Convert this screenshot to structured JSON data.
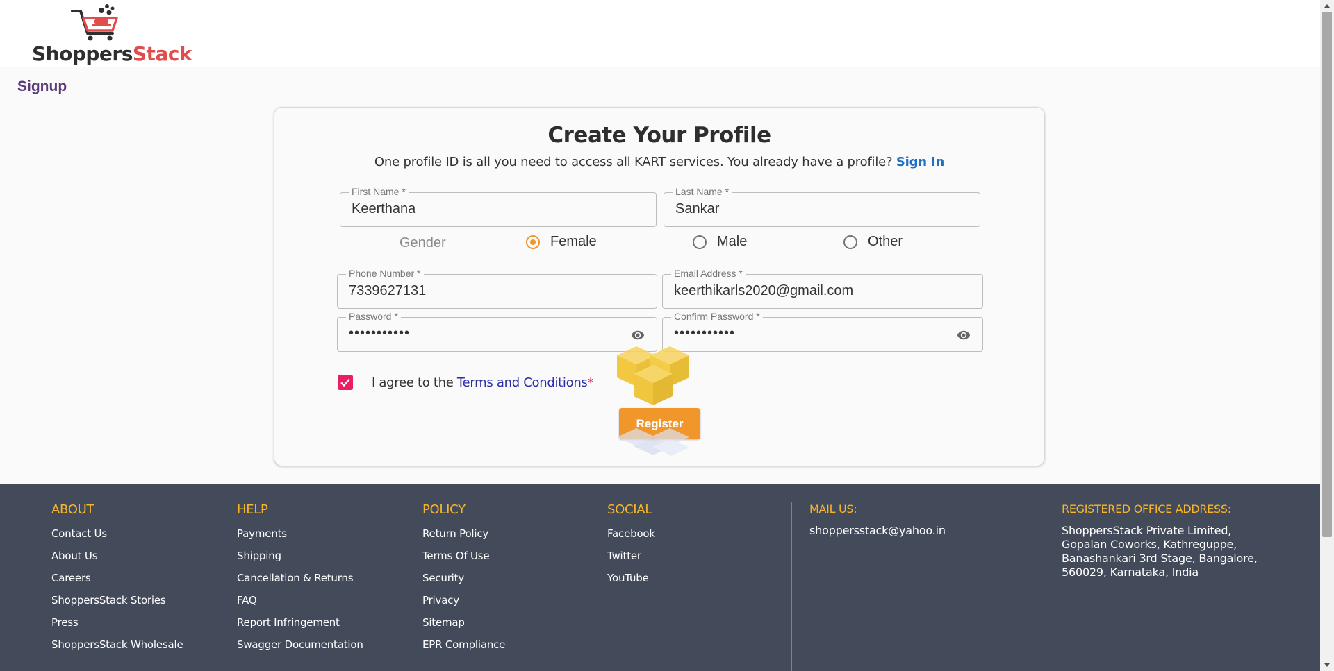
{
  "brand": {
    "name_part1": "Shoppers",
    "name_part2": "Stack",
    "accent": "#f0962b",
    "brand_red": "#e14d4d"
  },
  "page": {
    "title": "Signup"
  },
  "form": {
    "title": "Create Your Profile",
    "subtitle": "One profile ID is all you need to access all KART services. You already have a profile?",
    "sign_in_link": "Sign In",
    "first_name": {
      "label": "First Name *",
      "value": "Keerthana"
    },
    "last_name": {
      "label": "Last Name *",
      "value": "Sankar"
    },
    "gender": {
      "label": "Gender",
      "options": [
        "Female",
        "Male",
        "Other"
      ],
      "selected": "Female"
    },
    "phone": {
      "label": "Phone Number *",
      "value": "7339627131"
    },
    "email": {
      "label": "Email Address *",
      "value": "keerthikarls2020@gmail.com"
    },
    "password": {
      "label": "Password *",
      "value": "•••••••••••"
    },
    "confirm_password": {
      "label": "Confirm Password *",
      "value": "•••••••••••"
    },
    "agree_text": "I agree to the",
    "terms_link": "Terms and Conditions",
    "terms_required": "*",
    "terms_checked": true,
    "register_label": "Register"
  },
  "footer": {
    "about": {
      "heading": "ABOUT",
      "items": [
        "Contact Us",
        "About Us",
        "Careers",
        "ShoppersStack Stories",
        "Press",
        "ShoppersStack Wholesale"
      ]
    },
    "help": {
      "heading": "HELP",
      "items": [
        "Payments",
        "Shipping",
        "Cancellation & Returns",
        "FAQ",
        "Report Infringement",
        "Swagger Documentation"
      ]
    },
    "policy": {
      "heading": "POLICY",
      "items": [
        "Return Policy",
        "Terms Of Use",
        "Security",
        "Privacy",
        "Sitemap",
        "EPR Compliance"
      ]
    },
    "social": {
      "heading": "SOCIAL",
      "items": [
        "Facebook",
        "Twitter",
        "YouTube"
      ]
    },
    "mail": {
      "heading": "MAIL US:",
      "value": "shoppersstack@yahoo.in"
    },
    "office": {
      "heading": "REGISTERED OFFICE ADDRESS:",
      "lines": [
        "ShoppersStack Private Limited,",
        "Gopalan Coworks, Kathreguppe,",
        "Banashankari 3rd Stage, Bangalore,",
        "560029, Karnataka, India"
      ]
    }
  }
}
